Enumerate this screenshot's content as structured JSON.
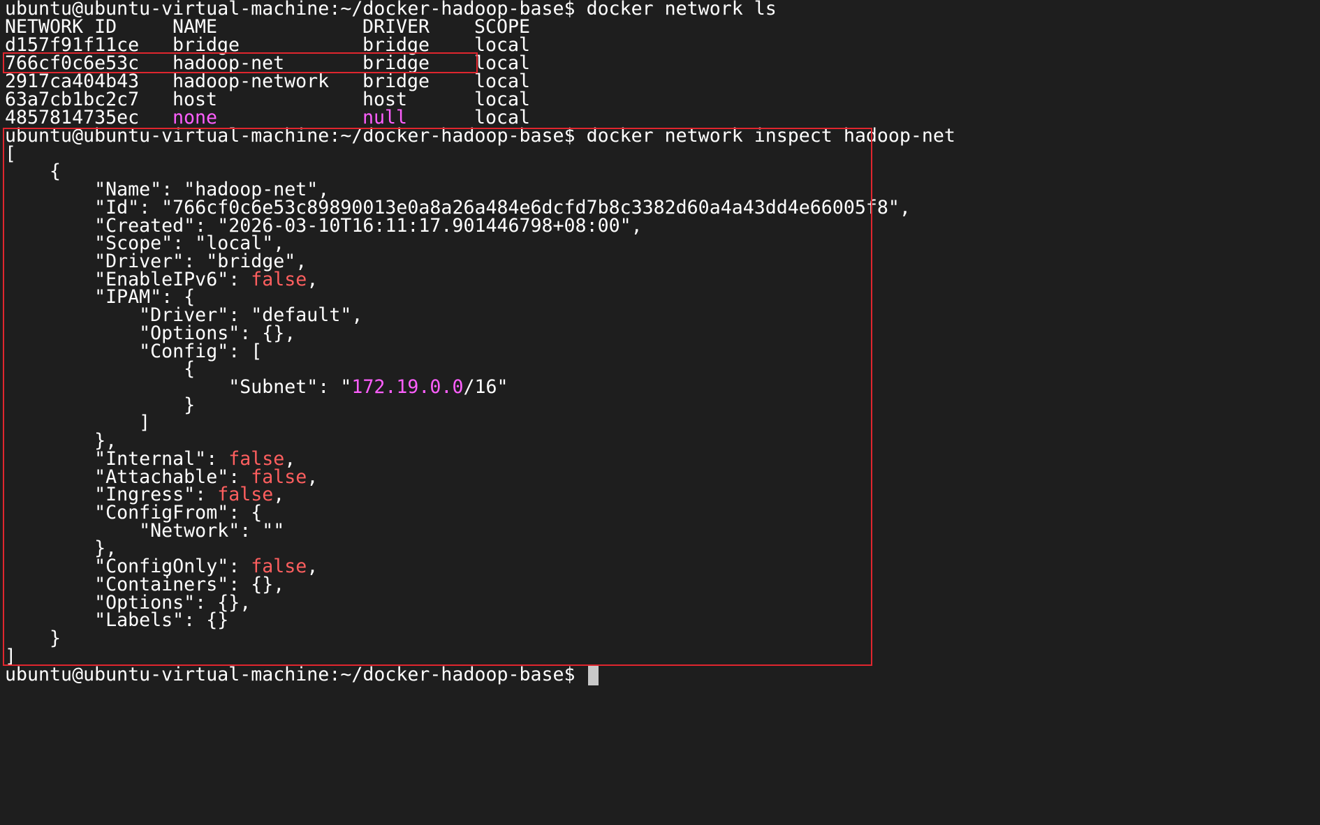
{
  "prompt": "ubuntu@ubuntu-virtual-machine:~/docker-hadoop-base$",
  "command_ls": "docker network ls",
  "command_inspect": "docker network inspect hadoop-net",
  "table": {
    "headers": [
      "NETWORK ID",
      "NAME",
      "DRIVER",
      "SCOPE"
    ],
    "rows": [
      [
        "d157f91f11ce",
        "bridge",
        "bridge",
        "local"
      ],
      [
        "766cf0c6e53c",
        "hadoop-net",
        "bridge",
        "local"
      ],
      [
        "2917ca404b43",
        "hadoop-network",
        "bridge",
        "local"
      ],
      [
        "63a7cb1bc2c7",
        "host",
        "host",
        "local"
      ],
      [
        "4857814735ec",
        "none",
        "null",
        "local"
      ]
    ]
  },
  "inspect": {
    "name": "hadoop-net",
    "id": "766cf0c6e53c89890013e0a8a26a484e6dcfd7b8c3382d60a4a43dd4e66005f8",
    "created": "2026-03-10T16:11:17.901446798+08:00",
    "scope": "local",
    "driver": "bridge",
    "enable_ipv6": "false",
    "ipam_driver": "default",
    "subnet_ip": "172.19.0.0",
    "subnet_mask": "/16",
    "internal": "false",
    "attachable": "false",
    "ingress": "false",
    "config_from_network": "",
    "config_only": "false"
  },
  "colors": {
    "background": "#1e1e1e",
    "text": "#ffffff",
    "boolean": "#ff5f5f",
    "special": "#ff5fff",
    "highlight_box": "#e0262e"
  }
}
